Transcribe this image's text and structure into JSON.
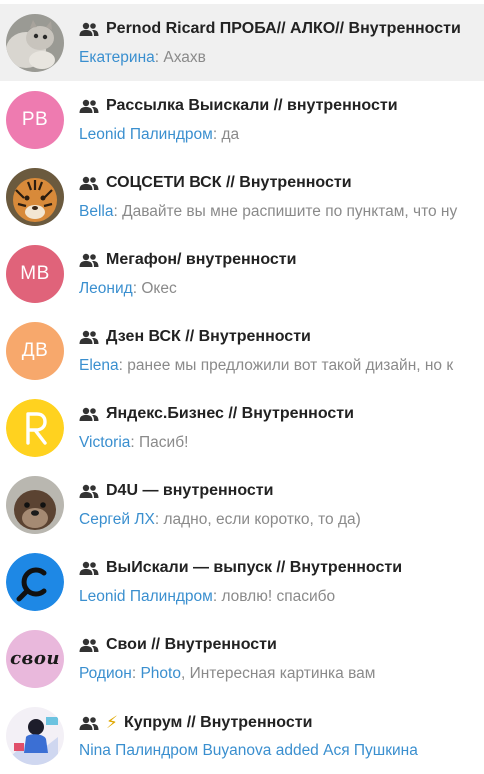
{
  "chats": [
    {
      "title": "Pernod Ricard ПРОБА// АЛКО// Внутренности",
      "sender": "Екатерина",
      "preview": "Ахахв",
      "selected": true,
      "avatar": {
        "type": "photo",
        "icon": "cat-photo"
      }
    },
    {
      "title": "Рассылка Выискали // внутренности",
      "sender": "Leonid Палиндром",
      "preview": "да",
      "avatar": {
        "type": "initials",
        "text": "PB",
        "color": "#ee7bb0"
      }
    },
    {
      "title": "СОЦСЕТИ ВСК // Внутренности",
      "sender": "Bella",
      "preview": "Давайте вы мне распишите по пунктам, что ну",
      "avatar": {
        "type": "photo",
        "icon": "tiger-photo"
      }
    },
    {
      "title": "Мегафон/ внутренности",
      "sender": "Леонид",
      "preview": "Окес",
      "avatar": {
        "type": "initials",
        "text": "MB",
        "color": "#e0637a"
      }
    },
    {
      "title": "Дзен ВСК // Внутренности",
      "sender": "Elena",
      "preview": "ранее мы предложили вот такой дизайн, но к",
      "avatar": {
        "type": "initials",
        "text": "ДВ",
        "color": "#f7a86c"
      }
    },
    {
      "title": "Яндекс.Бизнес // Внутренности",
      "sender": "Victoria",
      "preview": "Пасиб!",
      "avatar": {
        "type": "photo",
        "icon": "letter-r-logo"
      }
    },
    {
      "title": "D4U — внутренности",
      "sender": "Сергей ЛХ",
      "preview": "ладно, если коротко, то да)",
      "avatar": {
        "type": "photo",
        "icon": "otter-photo"
      }
    },
    {
      "title": "ВыИскали — выпуск // Внутренности",
      "sender": "Leonid Палиндром",
      "preview": "ловлю! спасибо",
      "avatar": {
        "type": "photo",
        "icon": "search-logo"
      }
    },
    {
      "title": "Свои // Внутренности",
      "sender": "Родион",
      "media": "Photo",
      "preview": "Интересная картинка вам",
      "avatar": {
        "type": "photo",
        "icon": "svoi-logo",
        "text": "свои"
      }
    },
    {
      "title": "Купрум // Внутренности",
      "bolt": "⚡",
      "sender": "",
      "preview": "",
      "system": "Nina Палиндром Buyanova added Ася Пушкина",
      "avatar": {
        "type": "photo",
        "icon": "illustration-photo"
      }
    }
  ],
  "icons": {
    "group": "group-icon",
    "bolt": "lightning-icon"
  }
}
